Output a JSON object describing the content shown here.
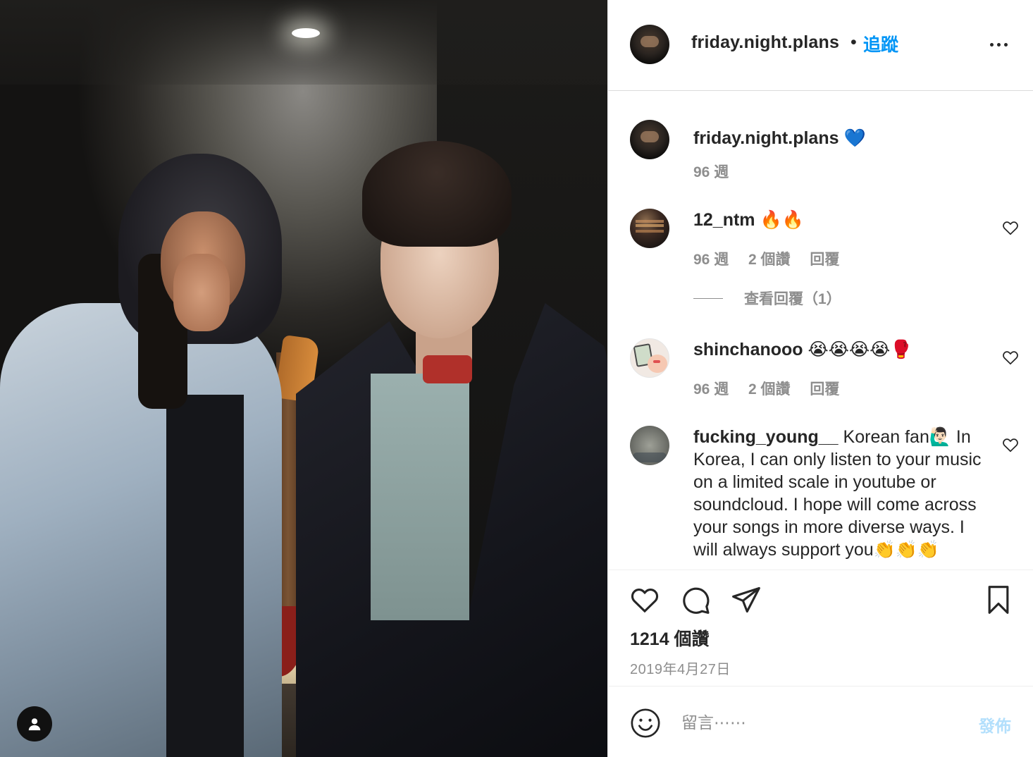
{
  "post": {
    "author": "friday.night.plans",
    "follow_label": "追蹤",
    "dot": "•"
  },
  "caption": {
    "username": "friday.night.plans",
    "text": "💙",
    "time": "96 週"
  },
  "comments": [
    {
      "username": "12_ntm",
      "text": "🔥🔥",
      "time": "96 週",
      "likes": "2 個讚",
      "reply_label": "回覆",
      "view_replies": "查看回覆（1）"
    },
    {
      "username": "shinchanooo",
      "text": "😭😭😭😭🥊",
      "time": "96 週",
      "likes": "2 個讚",
      "reply_label": "回覆"
    },
    {
      "username": "fucking_young__",
      "text": "Korean fan🙋🏻‍♂️ In Korea, I can only listen to your music on a limited scale in youtube or soundcloud. I hope will come across your songs in more diverse ways. I will always support you👏👏👏"
    }
  ],
  "stats": {
    "likes": "1214 個讚",
    "date": "2019年4月27日"
  },
  "compose": {
    "placeholder": "留言⋯⋯",
    "post_label": "發佈"
  },
  "colors": {
    "accent": "#0095f6",
    "post_disabled": "#b2dffc",
    "muted": "#8e8e8e",
    "text": "#262626"
  },
  "icons": {
    "more": "more-options-icon",
    "like": "heart-icon",
    "comment": "comment-bubble-icon",
    "share": "paper-plane-icon",
    "save": "bookmark-icon",
    "emoji": "smiley-icon",
    "account": "user-icon"
  }
}
